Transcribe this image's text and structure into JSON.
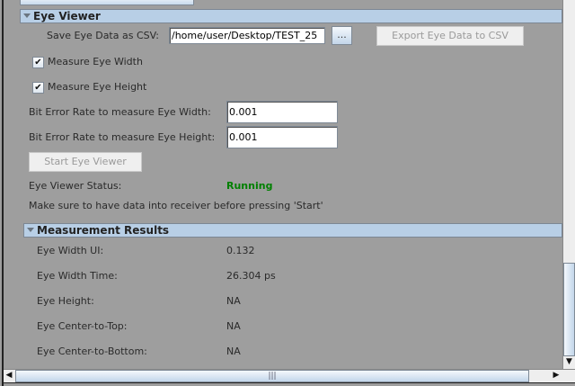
{
  "eye_viewer": {
    "section_title": "Eye Viewer",
    "save_csv_label": "Save Eye Data as CSV:",
    "save_csv_path": "/home/user/Desktop/TEST_25",
    "browse_label": "...",
    "export_label": "Export Eye Data to CSV",
    "measure_width_label": "Measure Eye Width",
    "measure_width_checked": true,
    "measure_height_label": "Measure Eye Height",
    "measure_height_checked": true,
    "ber_width_label": "Bit Error Rate to measure Eye Width:",
    "ber_width_value": "0.001",
    "ber_height_label": "Bit Error Rate to measure Eye Height:",
    "ber_height_value": "0.001",
    "start_label": "Start Eye Viewer",
    "status_label": "Eye Viewer Status:",
    "status_value": "Running",
    "status_color": "#008000",
    "hint": "Make sure to have data into receiver before pressing 'Start'"
  },
  "results": {
    "section_title": "Measurement Results",
    "rows": [
      {
        "label": "Eye Width UI:",
        "value": "0.132"
      },
      {
        "label": "Eye Width Time:",
        "value": "26.304 ps"
      },
      {
        "label": "Eye Height:",
        "value": "NA"
      },
      {
        "label": "Eye Center-to-Top:",
        "value": "NA"
      },
      {
        "label": "Eye Center-to-Bottom:",
        "value": "NA"
      }
    ]
  }
}
